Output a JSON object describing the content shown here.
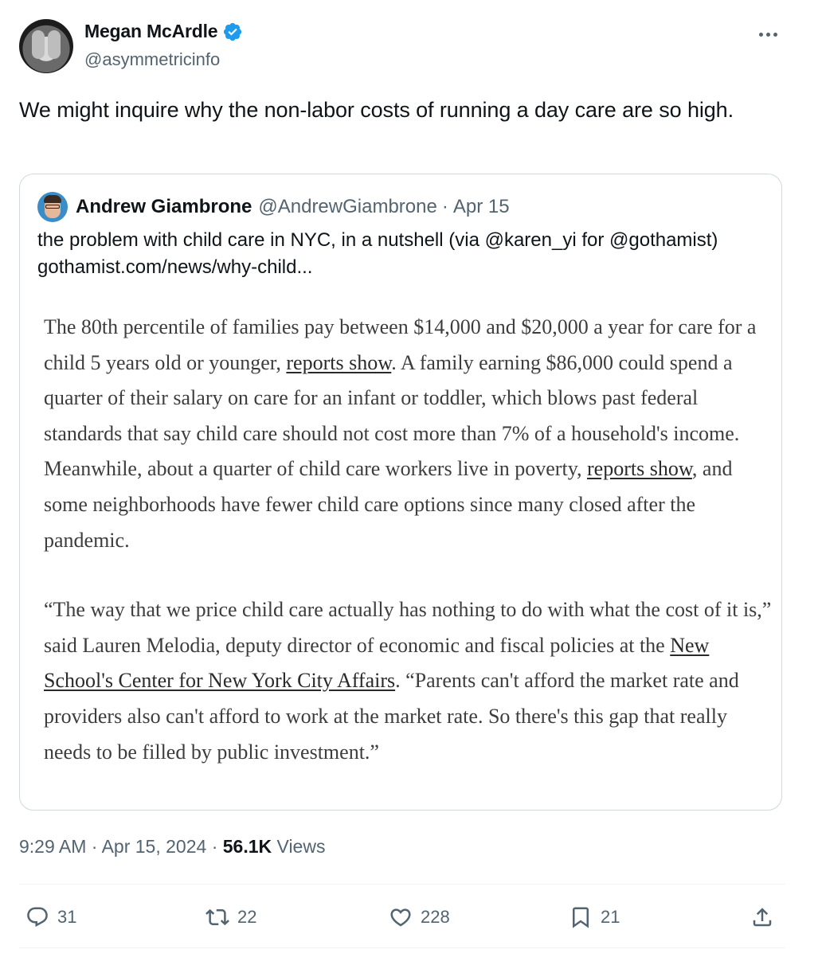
{
  "author": {
    "name": "Megan McArdle",
    "handle": "@asymmetricinfo",
    "verified_color": "#1d9bf0"
  },
  "tweet_text": "We might inquire why the non-labor costs of running a day care are so high.",
  "quoted": {
    "name": "Andrew Giambrone",
    "handle": "@AndrewGiambrone",
    "sep": "·",
    "date": "Apr 15",
    "text": "the problem with child care in NYC, in a nutshell (via @karen_yi for @gothamist) gothamist.com/news/why-child...",
    "article": {
      "p1_a": "The 80th percentile of families pay between $14,000 and $20,000 a year for care for a child 5 years old or younger, ",
      "p1_link1": "reports show",
      "p1_b": ". A family earning $86,000 could spend a quarter of their salary on care for an infant or toddler, which blows past federal standards that say child care should not cost more than 7% of a household's income. Meanwhile, about a quarter of child care workers live in poverty, ",
      "p1_link2": "reports show",
      "p1_c": ", and some neighborhoods have fewer child care options since many closed after the pandemic.",
      "p2_a": "“The way that we price child care actually has nothing to do with what the cost of it is,” said Lauren Melodia, deputy director of economic and fiscal policies at the ",
      "p2_link": "New School's Center for New York City Affairs",
      "p2_b": ". “Parents can't afford the market rate and providers also can't afford to work at the market rate. So there's this gap that really needs to be filled by public investment.”"
    }
  },
  "meta": {
    "time": "9:29 AM",
    "sep1": "·",
    "date": "Apr 15, 2024",
    "sep2": "·",
    "views_count": "56.1K",
    "views_label": "Views"
  },
  "actions": {
    "replies": "31",
    "reposts": "22",
    "likes": "228",
    "bookmarks": "21"
  },
  "colors": {
    "text": "#0f1419",
    "secondary": "#536471",
    "border": "#cfd9de"
  }
}
